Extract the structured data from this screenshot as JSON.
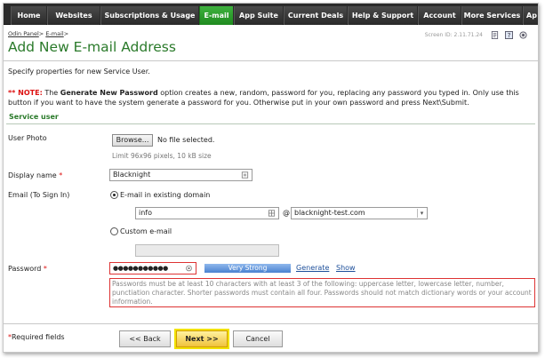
{
  "nav": {
    "tabs": [
      {
        "label": "Home"
      },
      {
        "label": "Websites"
      },
      {
        "label": "Subscriptions & Usage"
      },
      {
        "label": "E-mail"
      },
      {
        "label": "App Suite"
      },
      {
        "label": "Current Deals"
      },
      {
        "label": "Help & Support"
      },
      {
        "label": "Account"
      },
      {
        "label": "More Services"
      },
      {
        "label": "Ap"
      }
    ],
    "active_tab": "E-mail",
    "active_color": "#2f9e2f"
  },
  "breadcrumb": {
    "root": "Odin Panel",
    "sep": ">",
    "current": "E-mail",
    "tail": ">"
  },
  "screen_id": "Screen ID:  2.11.71.24",
  "page_title": "Add New E-mail Address",
  "intro": "Specify properties for new Service User.",
  "note": {
    "prefix": "** NOTE:",
    "text_a": " The ",
    "bold": "Generate New Password",
    "text_b": " option creates a new, random, password for you, replacing any password you typed in. Only use this button if you want to have the system generate a password for you. Otherwise put in your own password and press Next\\Submit."
  },
  "section_title": "Service user",
  "photo": {
    "label": "User Photo",
    "browse_label": "Browse...",
    "file_status": "No file selected.",
    "limit_hint": "Limit 96x96 pixels, 10 kB size"
  },
  "display_name": {
    "label": "Display name",
    "required_mark": "*",
    "value": "Blacknight"
  },
  "email": {
    "label": "Email (To Sign In)",
    "option_existing": "E-mail in existing domain",
    "local_part": "info",
    "at": "@",
    "domain": "blacknight-test.com",
    "option_custom": "Custom e-mail",
    "custom_value": ""
  },
  "password": {
    "label": "Password",
    "required_mark": "*",
    "value": "●●●●●●●●●●●",
    "strength_label": "Very Strong",
    "generate_label": "Generate",
    "show_label": "Show",
    "rules_text": "Passwords must be at least 10 characters with at least 3 of the following: uppercase letter, lowercase letter, number, punctiation character. Shorter passwords must contain all four. Passwords should not match dictionary words or your account information."
  },
  "footer": {
    "required_mark": "*",
    "required_text": "Required fields",
    "back_label": "<< Back",
    "next_label": "Next >>",
    "cancel_label": "Cancel"
  }
}
